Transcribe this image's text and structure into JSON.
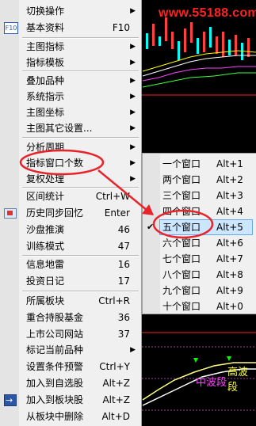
{
  "watermark": "www.55188.com",
  "chart": {
    "label_a": "高波段",
    "label_b": "中波段"
  },
  "menu": {
    "items": [
      {
        "label": "切换操作",
        "shortcut": "",
        "arrow": "▶"
      },
      {
        "label": "基本资料",
        "shortcut": "F10",
        "icon": "F10"
      },
      {
        "label": "主图指标",
        "shortcut": "",
        "arrow": "▶"
      },
      {
        "label": "指标模板",
        "shortcut": "",
        "arrow": "▶"
      },
      {
        "label": "叠加品种",
        "shortcut": "",
        "arrow": "▶"
      },
      {
        "label": "系统指示",
        "shortcut": "",
        "arrow": "▶"
      },
      {
        "label": "主图坐标",
        "shortcut": "",
        "arrow": "▶"
      },
      {
        "label": "主图其它设置...",
        "shortcut": "",
        "arrow": "▶"
      },
      {
        "label": "分析周期",
        "shortcut": "",
        "arrow": "▶"
      },
      {
        "label": "指标窗口个数",
        "shortcut": "",
        "arrow": "▶"
      },
      {
        "label": "复权处理",
        "shortcut": "",
        "arrow": "▶"
      },
      {
        "label": "区间统计",
        "shortcut": "Ctrl+W"
      },
      {
        "label": "历史同步回忆",
        "shortcut": "Enter"
      },
      {
        "label": "沙盘推演",
        "shortcut": "46"
      },
      {
        "label": "训练模式",
        "shortcut": "47"
      },
      {
        "label": "信息地雷",
        "shortcut": "16"
      },
      {
        "label": "投资日记",
        "shortcut": "17"
      },
      {
        "label": "所属板块",
        "shortcut": "Ctrl+R"
      },
      {
        "label": "重合持股基金",
        "shortcut": "36"
      },
      {
        "label": "上市公司网站",
        "shortcut": "37"
      },
      {
        "label": "标记当前品种",
        "shortcut": "",
        "arrow": "▶"
      },
      {
        "label": "设置条件预警",
        "shortcut": "Ctrl+Y"
      },
      {
        "label": "加入到自选股",
        "shortcut": "Alt+Z"
      },
      {
        "label": "加入到板块股",
        "shortcut": "Alt+Z"
      },
      {
        "label": "从板块中删除",
        "shortcut": "Alt+D"
      }
    ]
  },
  "submenu": {
    "items": [
      {
        "label": "一个窗口",
        "shortcut": "Alt+1"
      },
      {
        "label": "两个窗口",
        "shortcut": "Alt+2"
      },
      {
        "label": "三个窗口",
        "shortcut": "Alt+3"
      },
      {
        "label": "四个窗口",
        "shortcut": "Alt+4"
      },
      {
        "label": "五个窗口",
        "shortcut": "Alt+5",
        "checked": true
      },
      {
        "label": "六个窗口",
        "shortcut": "Alt+6"
      },
      {
        "label": "七个窗口",
        "shortcut": "Alt+7"
      },
      {
        "label": "八个窗口",
        "shortcut": "Alt+8"
      },
      {
        "label": "九个窗口",
        "shortcut": "Alt+9"
      },
      {
        "label": "十个窗口",
        "shortcut": "Alt+0"
      }
    ],
    "check_mark": "✔"
  },
  "colors": {
    "annotation": "#e8232a",
    "menu_bg": "#f0f0f0",
    "highlight": "#cde6ff"
  }
}
